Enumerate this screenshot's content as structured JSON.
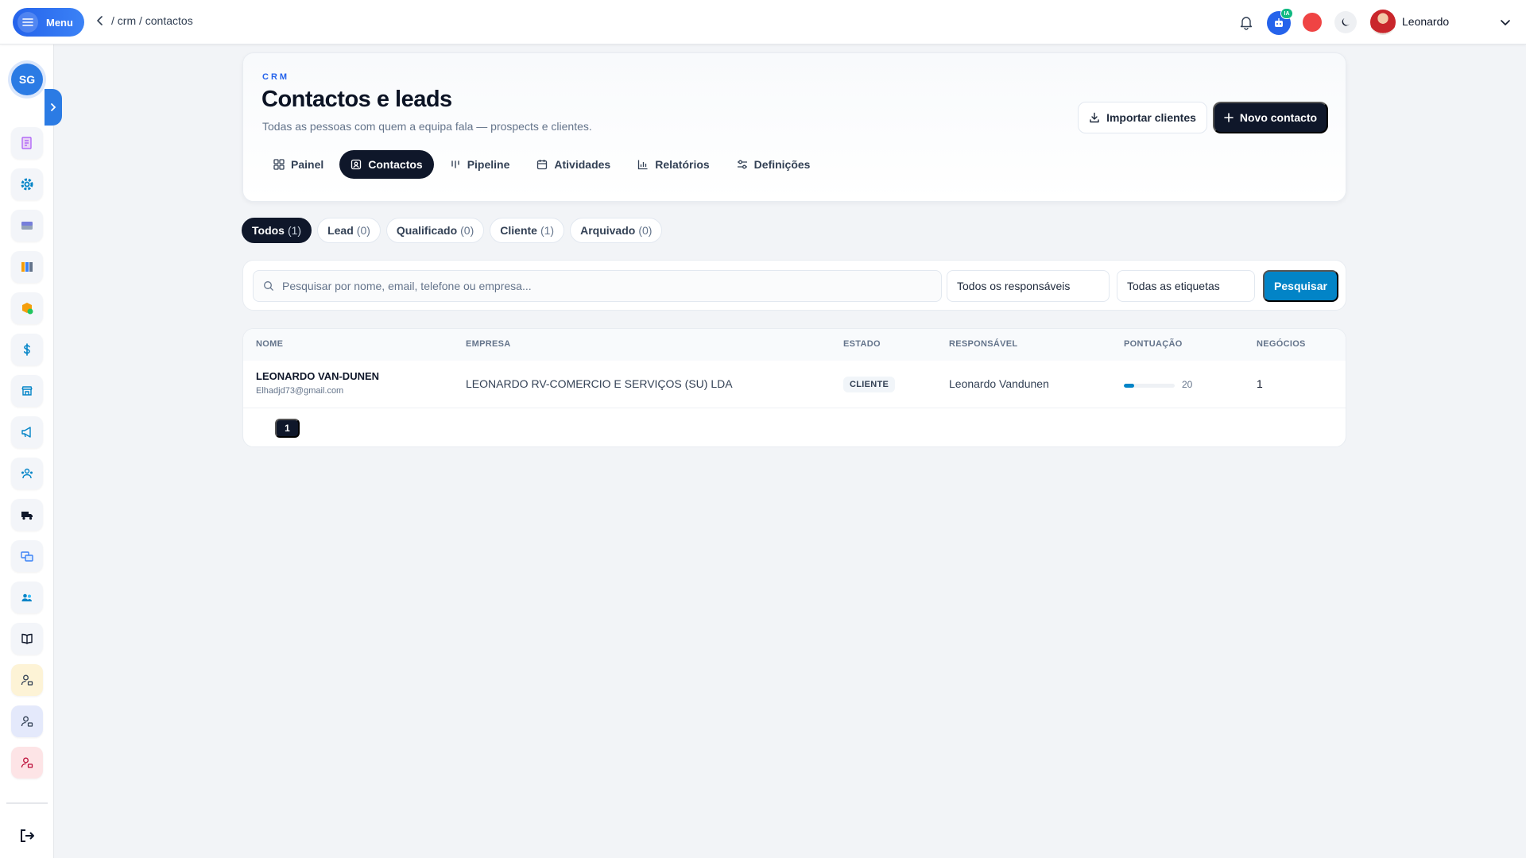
{
  "topbar": {
    "menu_label": "Menu",
    "breadcrumb": "/ crm / contactos",
    "ia_badge": "IA",
    "user_name": "Leonardo",
    "accent": "#2563eb"
  },
  "sidebar": {
    "workspace_initials": "SG",
    "items": [
      {
        "icon": "receipt-icon"
      },
      {
        "icon": "gear-icon"
      },
      {
        "icon": "card-icon"
      },
      {
        "icon": "books-icon"
      },
      {
        "icon": "box-icon"
      },
      {
        "icon": "dollar-icon"
      },
      {
        "icon": "store-icon"
      },
      {
        "icon": "megaphone-icon"
      },
      {
        "icon": "team-icon"
      },
      {
        "icon": "truck-icon"
      },
      {
        "icon": "transfer-icon"
      },
      {
        "icon": "users-icon"
      },
      {
        "icon": "book-icon"
      },
      {
        "icon": "user-lock-yellow-icon"
      },
      {
        "icon": "user-lock-blue-icon"
      },
      {
        "icon": "user-lock-red-icon"
      }
    ],
    "logout_icon": "logout-icon"
  },
  "header": {
    "kicker": "CRM",
    "title": "Contactos e leads",
    "subtitle": "Todas as pessoas com quem a equipa fala — prospects e clientes.",
    "import_label": "Importar clientes",
    "new_label": "Novo contacto",
    "tabs": [
      {
        "label": "Painel",
        "icon": "grid-icon",
        "active": false
      },
      {
        "label": "Contactos",
        "icon": "contact-icon",
        "active": true
      },
      {
        "label": "Pipeline",
        "icon": "pipeline-icon",
        "active": false
      },
      {
        "label": "Atividades",
        "icon": "calendar-icon",
        "active": false
      },
      {
        "label": "Relatórios",
        "icon": "bar-chart-icon",
        "active": false
      },
      {
        "label": "Definições",
        "icon": "sliders-icon",
        "active": false
      }
    ]
  },
  "filters": {
    "chips": [
      {
        "label": "Todos",
        "count": "(1)",
        "active": true
      },
      {
        "label": "Lead",
        "count": "(0)",
        "active": false
      },
      {
        "label": "Qualificado",
        "count": "(0)",
        "active": false
      },
      {
        "label": "Cliente",
        "count": "(1)",
        "active": false
      },
      {
        "label": "Arquivado",
        "count": "(0)",
        "active": false
      }
    ]
  },
  "search": {
    "placeholder": "Pesquisar por nome, email, telefone ou empresa...",
    "value": "",
    "owner_select": "Todos os responsáveis",
    "tag_select": "Todas as etiquetas",
    "button_label": "Pesquisar"
  },
  "table": {
    "columns": [
      "NOME",
      "EMPRESA",
      "ESTADO",
      "RESPONSÁVEL",
      "PONTUAÇÃO",
      "NEGÓCIOS"
    ],
    "rows": [
      {
        "name": "LEONARDO VAN-DUNEN",
        "email": "Elhadjd73@gmail.com",
        "company": "LEONARDO RV-COMERCIO E SERVIÇOS (SU) LDA",
        "status": "CLIENTE",
        "owner": "Leonardo Vandunen",
        "score": "20",
        "score_fraction": 0.2,
        "deals": "1"
      }
    ],
    "current_page": "1"
  }
}
